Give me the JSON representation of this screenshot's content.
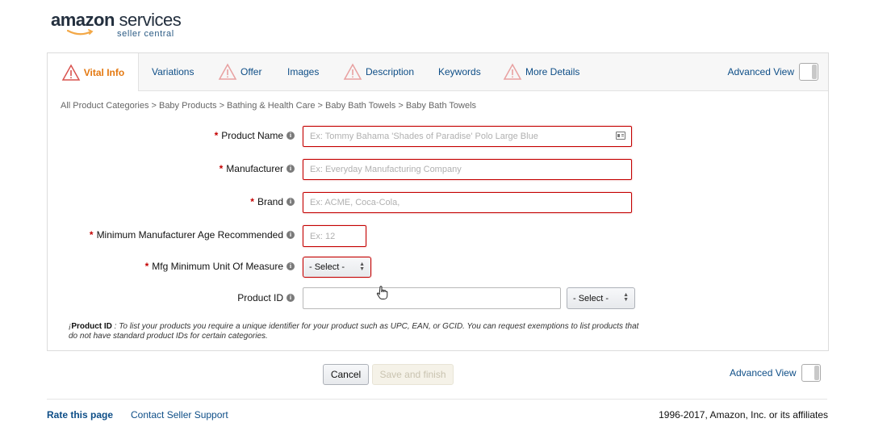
{
  "logo": {
    "brand_word": "amazon",
    "service_word": "services",
    "sub": "seller central"
  },
  "tabs": [
    {
      "label": "Vital Info",
      "icon": "warning-icon",
      "active": true
    },
    {
      "label": "Variations"
    },
    {
      "label": "Offer",
      "icon": "warning-icon"
    },
    {
      "label": "Images"
    },
    {
      "label": "Description",
      "icon": "warning-icon"
    },
    {
      "label": "Keywords"
    },
    {
      "label": "More Details",
      "icon": "warning-icon"
    }
  ],
  "advanced_view_label": "Advanced View",
  "breadcrumb": "All Product Categories > Baby Products > Bathing & Health Care > Baby Bath Towels > Baby Bath Towels",
  "form": {
    "product_name": {
      "label": "Product Name",
      "placeholder": "Ex: Tommy Bahama 'Shades of Paradise' Polo Large Blue"
    },
    "manufacturer": {
      "label": "Manufacturer",
      "placeholder": "Ex: Everyday Manufacturing Company"
    },
    "brand": {
      "label": "Brand",
      "placeholder": "Ex: ACME, Coca-Cola,"
    },
    "min_age": {
      "label": "Minimum Manufacturer Age Recommended",
      "placeholder": "Ex: 12"
    },
    "min_unit": {
      "label": "Mfg Minimum Unit Of Measure",
      "selected": "- Select -"
    },
    "product_id": {
      "label": "Product ID",
      "value": "",
      "type_selected": "- Select -"
    }
  },
  "note": {
    "prefix": "¡",
    "term": "Product ID",
    "text": " : To list your products you require a unique identifier for your product such as UPC, EAN, or GCID. You can request exemptions to list products that do not have standard product IDs for certain categories."
  },
  "buttons": {
    "cancel": "Cancel",
    "save": "Save and finish"
  },
  "footer": {
    "rate": "Rate this page",
    "contact": "Contact Seller Support",
    "copyright": "1996-2017, Amazon, Inc. or its affiliates"
  },
  "colors": {
    "accent_orange": "#e47911",
    "link_blue": "#0e4e87",
    "error_red": "#c40000"
  }
}
